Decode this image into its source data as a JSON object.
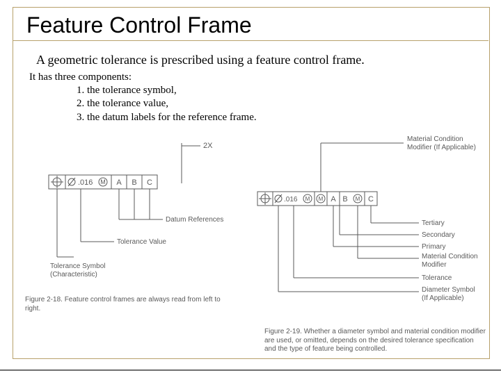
{
  "title": "Feature Control Frame",
  "intro": "A geometric tolerance is prescribed using a feature control frame.",
  "list_lead": "It has three components:",
  "list": {
    "i1": "1. the tolerance symbol,",
    "i2": "2. the tolerance value,",
    "i3": "3. the datum labels for the reference frame."
  },
  "fcf_left": {
    "tolerance": ".016",
    "datumA": "A",
    "datumB": "B",
    "datumC": "C",
    "two_x": "2X",
    "label_datum_refs": "Datum References",
    "label_tol_value": "Tolerance Value",
    "label_tol_symbol_line1": "Tolerance Symbol",
    "label_tol_symbol_line2": "(Characteristic)"
  },
  "fcf_right": {
    "tolerance": ".016",
    "datumA": "A",
    "datumB": "B",
    "datumC": "C",
    "label_mcm_top1": "Material Condition",
    "label_mcm_top2": "Modifier (If Applicable)",
    "label_tertiary": "Tertiary",
    "label_secondary": "Secondary",
    "label_primary": "Primary",
    "label_mcm_line1": "Material Condition",
    "label_mcm_line2": "Modifier",
    "label_tolerance": "Tolerance",
    "label_dia_line1": "Diameter Symbol",
    "label_dia_line2": "(If Applicable)"
  },
  "figure_left": "Figure 2-18. Feature control frames are always read from left to right.",
  "figure_right": "Figure 2-19. Whether a diameter symbol and material condition modifier are used, or omitted, depends on the desired tolerance specification and the type of feature being controlled."
}
